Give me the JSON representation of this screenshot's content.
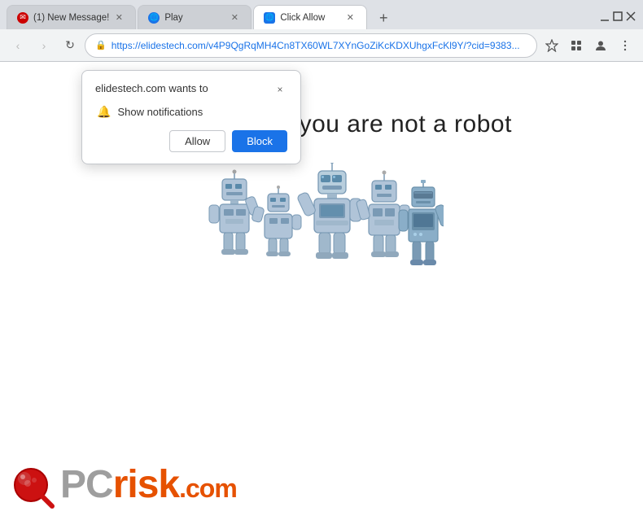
{
  "browser": {
    "tabs": [
      {
        "id": "tab1",
        "title": "(1) New Message!",
        "favicon": "mail",
        "active": false
      },
      {
        "id": "tab2",
        "title": "Play",
        "favicon": "globe",
        "active": false
      },
      {
        "id": "tab3",
        "title": "Click Allow",
        "favicon": "shield",
        "active": true
      }
    ],
    "address": "https://elidestech.com/v4P9QgRqMH4Cn8TX60WL7XYnGoZiKcKDXUhgxFcKl9Y/?cid=9383...",
    "window_controls": {
      "minimize": "─",
      "maximize": "□",
      "close": "✕"
    }
  },
  "notification_popup": {
    "title": "elidestech.com wants to",
    "permission": "Show notifications",
    "allow_label": "Allow",
    "block_label": "Block",
    "close_label": "×"
  },
  "page": {
    "headline": "Click \"Allow\"  if you are not   a robot"
  },
  "pcrisk": {
    "text_gray": "PC",
    "text_orange": "risk",
    "tld": ".com"
  },
  "nav": {
    "back": "‹",
    "forward": "›",
    "refresh": "↻"
  }
}
